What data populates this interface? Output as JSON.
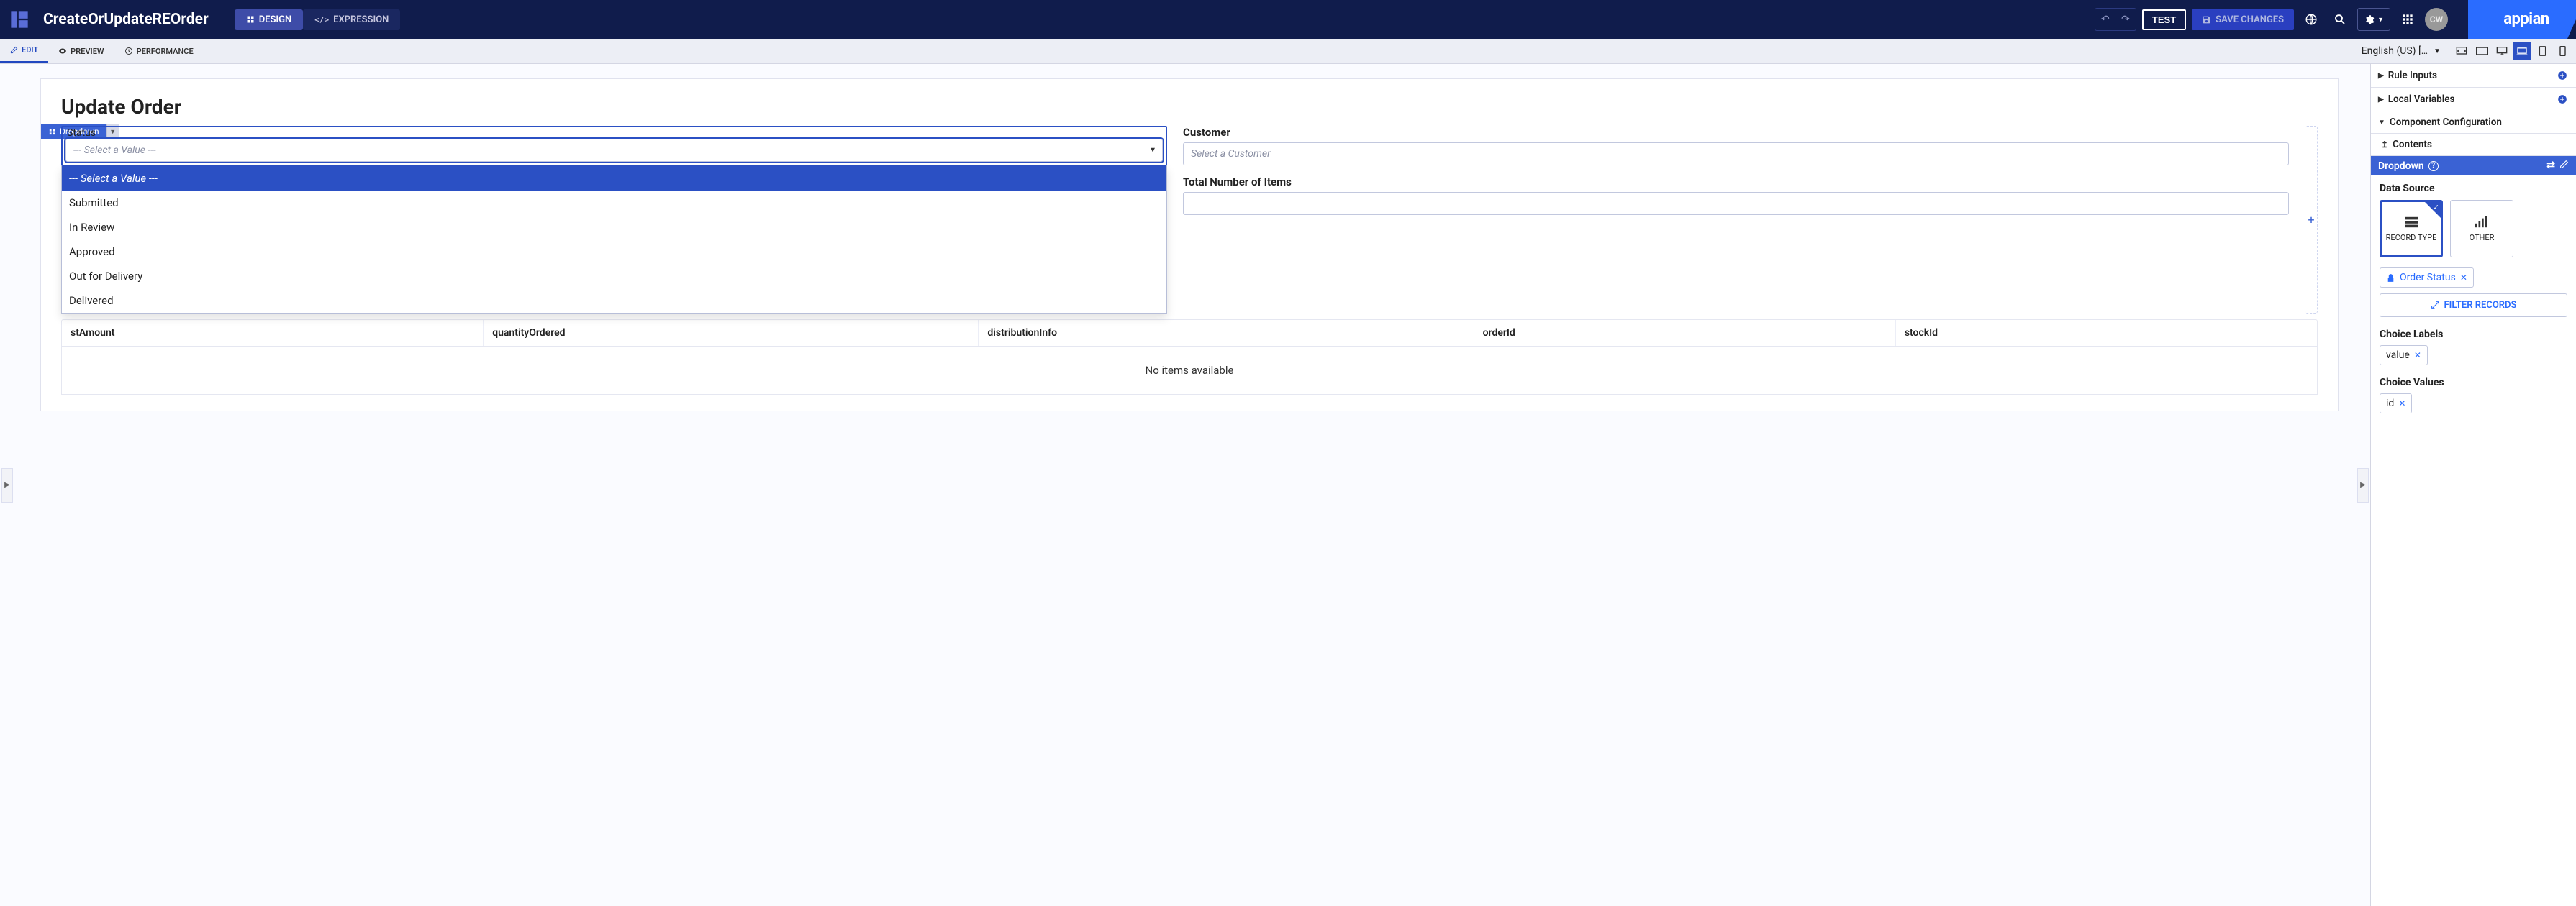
{
  "topbar": {
    "title": "CreateOrUpdateREOrder",
    "design_label": "DESIGN",
    "expression_label": "EXPRESSION",
    "test_label": "TEST",
    "save_label": "SAVE CHANGES",
    "avatar_initials": "CW",
    "brand": "appian"
  },
  "subtabs": {
    "edit": "EDIT",
    "preview": "PREVIEW",
    "performance": "PERFORMANCE",
    "language": "English (US) […"
  },
  "form": {
    "title": "Update Order",
    "component_tag": "Dropdown",
    "status_label": "Status",
    "status_placeholder": "--- Select a Value ---",
    "status_options": [
      "--- Select a Value ---",
      "Submitted",
      "In Review",
      "Approved",
      "Out for Delivery",
      "Delivered"
    ],
    "customer_label": "Customer",
    "customer_placeholder": "Select a Customer",
    "total_items_label": "Total Number of Items",
    "grid_columns_visible": [
      "stAmount",
      "quantityOrdered",
      "distributionInfo",
      "orderId",
      "stockId"
    ],
    "grid_empty": "No items available"
  },
  "rightpanel": {
    "rule_inputs": "Rule Inputs",
    "local_variables": "Local Variables",
    "component_config": "Component Configuration",
    "contents": "Contents",
    "selected_component": "Dropdown",
    "data_source_label": "Data Source",
    "ds_record_type": "RECORD TYPE",
    "ds_other": "OTHER",
    "record_chip": "Order Status",
    "filter_records": "FILTER RECORDS",
    "choice_labels": "Choice Labels",
    "choice_labels_value": "value",
    "choice_values": "Choice Values",
    "choice_values_value": "id"
  }
}
